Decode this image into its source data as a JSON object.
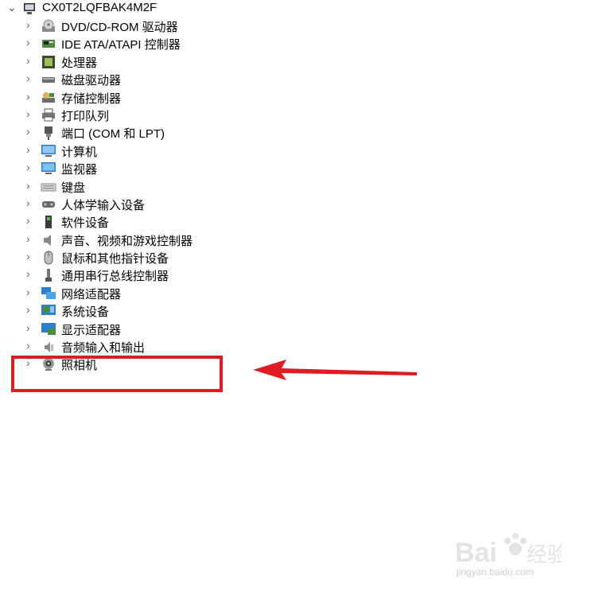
{
  "root": {
    "label": "CX0T2LQFBAK4M2F",
    "icon": "computer-icon"
  },
  "devices": [
    {
      "label": "DVD/CD-ROM 驱动器",
      "icon": "dvd-drive-icon"
    },
    {
      "label": "IDE ATA/ATAPI 控制器",
      "icon": "ide-controller-icon"
    },
    {
      "label": "处理器",
      "icon": "processor-icon"
    },
    {
      "label": "磁盘驱动器",
      "icon": "disk-drive-icon"
    },
    {
      "label": "存储控制器",
      "icon": "storage-controller-icon"
    },
    {
      "label": "打印队列",
      "icon": "printer-icon"
    },
    {
      "label": "端口 (COM 和 LPT)",
      "icon": "port-icon"
    },
    {
      "label": "计算机",
      "icon": "computer-monitor-icon"
    },
    {
      "label": "监视器",
      "icon": "monitor-icon"
    },
    {
      "label": "键盘",
      "icon": "keyboard-icon"
    },
    {
      "label": "人体学输入设备",
      "icon": "hid-icon"
    },
    {
      "label": "软件设备",
      "icon": "software-device-icon"
    },
    {
      "label": "声音、视频和游戏控制器",
      "icon": "speaker-icon"
    },
    {
      "label": "鼠标和其他指针设备",
      "icon": "mouse-icon"
    },
    {
      "label": "通用串行总线控制器",
      "icon": "usb-icon"
    },
    {
      "label": "网络适配器",
      "icon": "network-adapter-icon"
    },
    {
      "label": "系统设备",
      "icon": "system-device-icon"
    },
    {
      "label": "显示适配器",
      "icon": "display-adapter-icon"
    },
    {
      "label": "音频输入和输出",
      "icon": "audio-io-icon"
    },
    {
      "label": "照相机",
      "icon": "camera-icon"
    }
  ],
  "watermark": {
    "brand": "Bai百经验",
    "url": "jingyan.baidu.com"
  },
  "colors": {
    "highlight": "#e11b22",
    "arrow": "#e11b22"
  }
}
